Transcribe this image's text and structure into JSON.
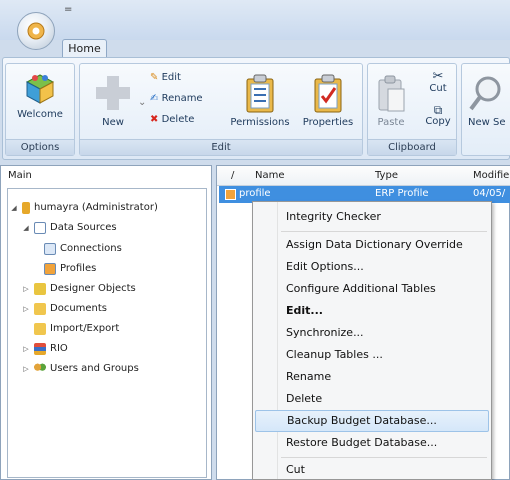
{
  "quick_access": {
    "label": "="
  },
  "tabs": [
    {
      "label": "Home"
    }
  ],
  "ribbon": {
    "groups": {
      "options": {
        "label": "Options"
      },
      "edit": {
        "label": "Edit"
      },
      "clipboard": {
        "label": "Clipboard"
      }
    },
    "buttons": {
      "welcome": "Welcome",
      "new": "New",
      "edit": "Edit",
      "rename": "Rename",
      "delete": "Delete",
      "permissions": "Permissions",
      "properties": "Properties",
      "paste": "Paste",
      "cut": "Cut",
      "copy": "Copy",
      "new_search": "New Se"
    }
  },
  "left_panel": {
    "tab": "Main",
    "tree": [
      {
        "label": "humayra (Administrator)"
      },
      {
        "label": "Data Sources"
      },
      {
        "label": "Connections"
      },
      {
        "label": "Profiles"
      },
      {
        "label": "Designer Objects"
      },
      {
        "label": "Documents"
      },
      {
        "label": "Import/Export"
      },
      {
        "label": "RIO"
      },
      {
        "label": "Users and Groups"
      }
    ]
  },
  "list": {
    "columns": {
      "sort": "/",
      "name": "Name",
      "type": "Type",
      "modified": "Modifie"
    },
    "rows": [
      {
        "name": "profile",
        "type": "ERP Profile",
        "modified": "04/05/"
      }
    ]
  },
  "context_menu": {
    "items": [
      "Integrity Checker",
      "Assign Data Dictionary Override",
      "Edit Options...",
      "Configure Additional Tables",
      "Edit...",
      "Synchronize...",
      "Cleanup Tables ...",
      "Rename",
      "Delete",
      "Backup Budget Database...",
      "Restore Budget Database...",
      "Cut"
    ],
    "highlighted": "Backup Budget Database..."
  },
  "colors": {
    "selection": "#3f8fe0",
    "accent": "#cfdcec",
    "menu_highlight": "#d5e7f9"
  }
}
